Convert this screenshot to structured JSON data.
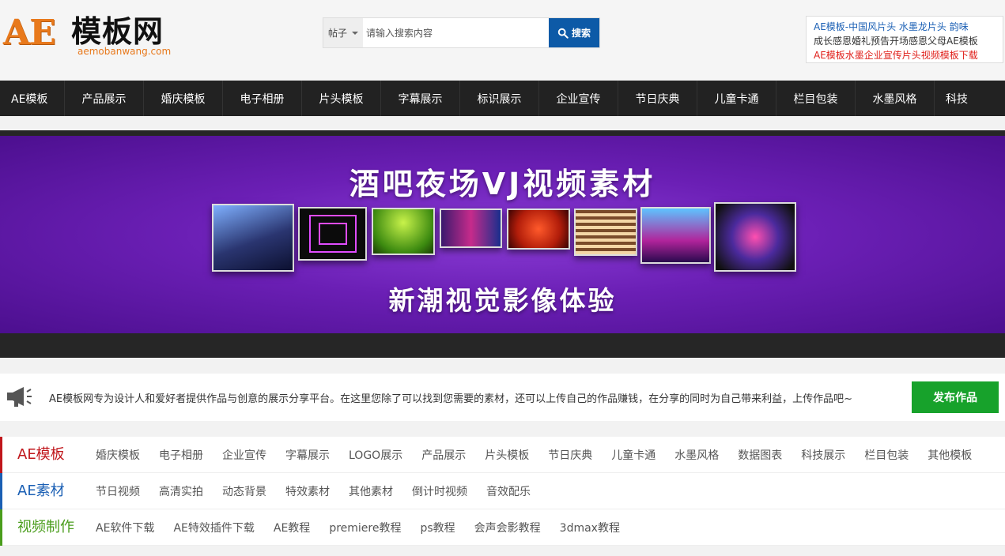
{
  "header": {
    "logo": {
      "ae": "AE",
      "cn": "模板网",
      "url": "aemobanwang.com"
    },
    "search": {
      "type_label": "帖子",
      "placeholder": "请输入搜索内容",
      "button_label": "搜索"
    },
    "hot_links": [
      "AE模板-中国风片头 水墨龙片头 韵味",
      "成长感恩婚礼预告开场感恩父母AE模板",
      "AE模板水墨企业宣传片头视频模板下载"
    ]
  },
  "nav": {
    "items": [
      "AE模板",
      "产品展示",
      "婚庆模板",
      "电子相册",
      "片头模板",
      "字幕展示",
      "标识展示",
      "企业宣传",
      "节日庆典",
      "儿童卡通",
      "栏目包装",
      "水墨风格",
      "科技"
    ]
  },
  "banner": {
    "title": "酒吧夜场VJ视频素材",
    "subtitle": "新潮视觉影像体验"
  },
  "notice": {
    "text": "AE模板网专为设计人和爱好者提供作品与创意的展示分享平台。在这里您除了可以找到您需要的素材，还可以上传自己的作品赚钱，在分享的同时为自己带来利益，上传作品吧~",
    "button_label": "发布作品"
  },
  "categories": [
    {
      "title": "AE模板",
      "color": "#c0161b",
      "links": [
        "婚庆模板",
        "电子相册",
        "企业宣传",
        "字幕展示",
        "LOGO展示",
        "产品展示",
        "片头模板",
        "节日庆典",
        "儿童卡通",
        "水墨风格",
        "数据图表",
        "科技展示",
        "栏目包装",
        "其他模板"
      ]
    },
    {
      "title": "AE素材",
      "color": "#1a5fb4",
      "links": [
        "节日视频",
        "高清实拍",
        "动态背景",
        "特效素材",
        "其他素材",
        "倒计时视频",
        "音效配乐"
      ]
    },
    {
      "title": "视频制作",
      "color": "#4a9d1c",
      "links": [
        "AE软件下载",
        "AE特效插件下载",
        "AE教程",
        "premiere教程",
        "ps教程",
        "会声会影教程",
        "3dmax教程"
      ]
    }
  ],
  "colors": {
    "nav_bg": "#222222",
    "search_button": "#0d5aa7",
    "publish_button": "#17a22b",
    "logo_orange": "#e8791c"
  }
}
